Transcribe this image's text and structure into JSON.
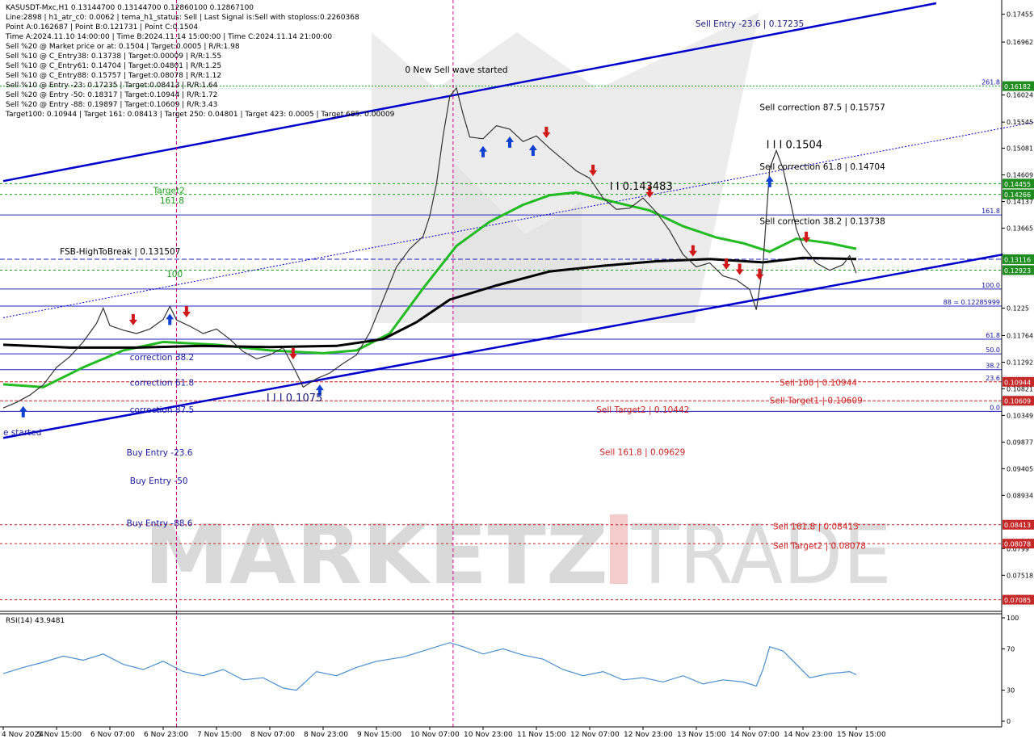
{
  "info_lines": [
    "KASUSDT-Mxc,H1  0.13144700 0.13144700 0.12860100 0.12867100",
    "Line:2898 | h1_atr_c0: 0.0062 | tema_h1_status: Sell | Last Signal is:Sell with stoploss:0.2260368",
    "Point A:0.162687 | Point B:0.121731 | Point C:0.1504",
    "Time A:2024.11.10 14:00:00 | Time B:2024.11.14 15:00:00 | Time C:2024.11.14 21:00:00",
    "Sell %20 @ Market price or at: 0.1504 | Target:0.0005 | R/R:1.98",
    "Sell %10 @ C_Entry38: 0.13738 | Target:0.00009 | R/R:1.55",
    "Sell %10 @ C_Entry61: 0.14704 | Target:0.04801 | R/R:1.25",
    "Sell %10 @ C_Entry88: 0.15757 | Target:0.08078 | R/R:1.12",
    "Sell %10 @ Entry -23: 0.17235 | Target:0.08413 | R/R:1.64",
    "Sell %20 @ Entry -50: 0.18317 | Target:0.10944 | R/R:1.72",
    "Sell %20 @ Entry -88: 0.19897 | Target:0.10609 | R/R:3.43",
    "Target100: 0.10944 | Target 161: 0.08413 | Target 250: 0.04801 | Target 423: 0.0005 | Target 685: 0.00009"
  ],
  "watermark": {
    "left": "MARKETZ",
    "right": "TRADE"
  },
  "rsi_label": "RSI(14) 43.9481",
  "chart_data": {
    "type": "line",
    "title": "KASUSDT-Mxc,H1",
    "ylim": [
      0.0695,
      0.1765
    ],
    "y_ticks": [
      0.17455,
      0.16962,
      0.16024,
      0.15545,
      0.15081,
      0.14609,
      0.14137,
      0.13665,
      0.1225,
      0.11764,
      0.11292,
      0.10821,
      0.10349,
      0.09877,
      0.09405,
      0.08934,
      0.0799,
      0.07518
    ],
    "x_labels": [
      {
        "label": "4 Nov 2024",
        "x": 0
      },
      {
        "label": "5 Nov 15:00",
        "x": 16
      },
      {
        "label": "6 Nov 07:00",
        "x": 32
      },
      {
        "label": "6 Nov 23:00",
        "x": 48
      },
      {
        "label": "7 Nov 15:00",
        "x": 64
      },
      {
        "label": "8 Nov 07:00",
        "x": 80
      },
      {
        "label": "8 Nov 23:00",
        "x": 96
      },
      {
        "label": "9 Nov 15:00",
        "x": 112
      },
      {
        "label": "10 Nov 07:00",
        "x": 128
      },
      {
        "label": "10 Nov 23:00",
        "x": 144
      },
      {
        "label": "11 Nov 15:00",
        "x": 160
      },
      {
        "label": "12 Nov 07:00",
        "x": 176
      },
      {
        "label": "12 Nov 23:00",
        "x": 192
      },
      {
        "label": "13 Nov 15:00",
        "x": 208
      },
      {
        "label": "14 Nov 07:00",
        "x": 224
      },
      {
        "label": "14 Nov 23:00",
        "x": 240
      },
      {
        "label": "15 Nov 15:00",
        "x": 256
      }
    ],
    "price_path": [
      [
        0,
        0.1048
      ],
      [
        4,
        0.1058
      ],
      [
        8,
        0.1071
      ],
      [
        12,
        0.1089
      ],
      [
        16,
        0.112
      ],
      [
        20,
        0.1139
      ],
      [
        24,
        0.1165
      ],
      [
        28,
        0.1198
      ],
      [
        30,
        0.1225
      ],
      [
        32,
        0.1194
      ],
      [
        36,
        0.1186
      ],
      [
        40,
        0.118
      ],
      [
        44,
        0.1188
      ],
      [
        48,
        0.1205
      ],
      [
        50,
        0.1228
      ],
      [
        52,
        0.1204
      ],
      [
        56,
        0.1193
      ],
      [
        60,
        0.118
      ],
      [
        64,
        0.1188
      ],
      [
        68,
        0.117
      ],
      [
        72,
        0.1148
      ],
      [
        76,
        0.1135
      ],
      [
        80,
        0.1142
      ],
      [
        84,
        0.1155
      ],
      [
        88,
        0.111
      ],
      [
        90,
        0.1085
      ],
      [
        94,
        0.11
      ],
      [
        98,
        0.111
      ],
      [
        102,
        0.1127
      ],
      [
        106,
        0.1142
      ],
      [
        110,
        0.1182
      ],
      [
        114,
        0.124
      ],
      [
        118,
        0.1298
      ],
      [
        122,
        0.133
      ],
      [
        126,
        0.1352
      ],
      [
        128,
        0.1388
      ],
      [
        130,
        0.1445
      ],
      [
        132,
        0.153
      ],
      [
        134,
        0.16
      ],
      [
        136,
        0.1615
      ],
      [
        138,
        0.1568
      ],
      [
        140,
        0.1528
      ],
      [
        144,
        0.1525
      ],
      [
        148,
        0.1548
      ],
      [
        152,
        0.1542
      ],
      [
        156,
        0.152
      ],
      [
        160,
        0.153
      ],
      [
        164,
        0.1508
      ],
      [
        168,
        0.1488
      ],
      [
        172,
        0.1468
      ],
      [
        176,
        0.1455
      ],
      [
        180,
        0.142
      ],
      [
        184,
        0.14
      ],
      [
        188,
        0.1402
      ],
      [
        192,
        0.142
      ],
      [
        196,
        0.1395
      ],
      [
        200,
        0.1362
      ],
      [
        204,
        0.132
      ],
      [
        208,
        0.1298
      ],
      [
        212,
        0.1305
      ],
      [
        216,
        0.1282
      ],
      [
        220,
        0.1275
      ],
      [
        224,
        0.1258
      ],
      [
        226,
        0.1222
      ],
      [
        228,
        0.1302
      ],
      [
        230,
        0.1472
      ],
      [
        232,
        0.1504
      ],
      [
        234,
        0.1472
      ],
      [
        236,
        0.142
      ],
      [
        238,
        0.1365
      ],
      [
        240,
        0.1335
      ],
      [
        244,
        0.1305
      ],
      [
        248,
        0.1292
      ],
      [
        252,
        0.1302
      ],
      [
        254,
        0.1318
      ],
      [
        256,
        0.1287
      ]
    ],
    "series": [
      {
        "name": "EMA50",
        "color": "#22bb22",
        "values": [
          [
            0,
            0.109
          ],
          [
            12,
            0.1085
          ],
          [
            24,
            0.112
          ],
          [
            36,
            0.115
          ],
          [
            48,
            0.1165
          ],
          [
            64,
            0.116
          ],
          [
            80,
            0.115
          ],
          [
            96,
            0.1145
          ],
          [
            106,
            0.115
          ],
          [
            116,
            0.118
          ],
          [
            126,
            0.126
          ],
          [
            136,
            0.1335
          ],
          [
            146,
            0.1378
          ],
          [
            156,
            0.1408
          ],
          [
            164,
            0.1425
          ],
          [
            172,
            0.143
          ],
          [
            184,
            0.1412
          ],
          [
            194,
            0.1398
          ],
          [
            204,
            0.137
          ],
          [
            214,
            0.135
          ],
          [
            222,
            0.134
          ],
          [
            230,
            0.1325
          ],
          [
            238,
            0.1348
          ],
          [
            248,
            0.134
          ],
          [
            256,
            0.133
          ]
        ]
      },
      {
        "name": "SMA200",
        "color": "#000000",
        "values": [
          [
            0,
            0.116
          ],
          [
            20,
            0.1155
          ],
          [
            40,
            0.1155
          ],
          [
            60,
            0.1158
          ],
          [
            80,
            0.1156
          ],
          [
            100,
            0.1158
          ],
          [
            114,
            0.117
          ],
          [
            124,
            0.12
          ],
          [
            134,
            0.124
          ],
          [
            148,
            0.1265
          ],
          [
            164,
            0.129
          ],
          [
            180,
            0.13
          ],
          [
            196,
            0.1308
          ],
          [
            212,
            0.1312
          ],
          [
            228,
            0.1306
          ],
          [
            240,
            0.1314
          ],
          [
            256,
            0.1312
          ]
        ]
      }
    ],
    "horizontal_levels": [
      {
        "value": 0.16182,
        "color": "#1a9f1a",
        "dash": "2,2",
        "axis_box": "0.16182",
        "label": "261.8",
        "label_color": "#1010a0"
      },
      {
        "value": 0.14455,
        "color": "#1a9f1a",
        "dash": "3,3",
        "axis_box": "0.14455",
        "label": "",
        "label_color": ""
      },
      {
        "value": 0.14266,
        "color": "#1a9f1a",
        "dash": "3,3",
        "axis_box": "0.14266",
        "label": "",
        "label_color": ""
      },
      {
        "value": 0.139,
        "color": "#2020c0",
        "dash": "",
        "axis_box": "",
        "label": "161.8",
        "label_color": "#1010a0"
      },
      {
        "value": 0.13116,
        "color": "#2020c0",
        "dash": "6,3",
        "axis_box": "0.13116",
        "label": "",
        "label_color": ""
      },
      {
        "value": 0.12923,
        "color": "#1a9f1a",
        "dash": "3,3",
        "axis_box": "0.12923",
        "label": "",
        "label_color": ""
      },
      {
        "value": 0.12587,
        "color": "#2020c0",
        "dash": "",
        "axis_box": "",
        "label": "100.0",
        "label_color": "#1010a0"
      },
      {
        "value": 0.12286,
        "color": "#2020c0",
        "dash": "",
        "axis_box": "",
        "label": "88 = 0.12285999",
        "label_color": "#1010a0"
      },
      {
        "value": 0.117,
        "color": "#2020c0",
        "dash": "",
        "axis_box": "",
        "label": "61.8",
        "label_color": "#1010a0"
      },
      {
        "value": 0.1144,
        "color": "#2020c0",
        "dash": "",
        "axis_box": "",
        "label": "50.0",
        "label_color": "#1010a0"
      },
      {
        "value": 0.1116,
        "color": "#2020c0",
        "dash": "",
        "axis_box": "",
        "label": "38.2",
        "label_color": "#1010a0"
      },
      {
        "value": 0.10944,
        "color": "#cc2222",
        "dash": "4,2",
        "axis_box": "0.10944",
        "label": "23.6",
        "label_color": "#1010a0"
      },
      {
        "value": 0.10609,
        "color": "#cc2222",
        "dash": "4,2",
        "axis_box": "0.10609",
        "label": "",
        "label_color": ""
      },
      {
        "value": 0.1042,
        "color": "#2020c0",
        "dash": "",
        "axis_box": "",
        "label": "0.0",
        "label_color": "#1010a0"
      },
      {
        "value": 0.08413,
        "color": "#cc2222",
        "dash": "3,3",
        "axis_box": "0.08413",
        "label": "",
        "label_color": ""
      },
      {
        "value": 0.08078,
        "color": "#cc2222",
        "dash": "3,3",
        "axis_box": "0.08078",
        "label": "",
        "label_color": ""
      },
      {
        "value": 0.07085,
        "color": "#cc2222",
        "dash": "3,3",
        "axis_box": "0.07085",
        "label": "",
        "label_color": ""
      }
    ],
    "annotations": [
      {
        "text": "Sell Entry -23.6 | 0.17235",
        "x": 224,
        "y": 0.17235,
        "color": "#1a1a7a",
        "anchor": "middle"
      },
      {
        "text": "0 New Sell wave started",
        "x": 136,
        "y": 0.1642,
        "color": "#000000",
        "anchor": "middle"
      },
      {
        "text": "Sell correction 87.5 | 0.15757",
        "x": 227,
        "y": 0.15757,
        "color": "#000000",
        "anchor": "start"
      },
      {
        "text": "I I I 0.1504",
        "x": 229,
        "y": 0.1508,
        "color": "#000000",
        "anchor": "start"
      },
      {
        "text": "Sell correction 61.8 | 0.14704",
        "x": 227,
        "y": 0.14704,
        "color": "#000000",
        "anchor": "start"
      },
      {
        "text": "I I 0.143483",
        "x": 182,
        "y": 0.14348,
        "color": "#000000",
        "anchor": "start"
      },
      {
        "text": "Target2",
        "x": 45,
        "y": 0.1428,
        "color": "#1a9f1a",
        "anchor": "start"
      },
      {
        "text": "161.8",
        "x": 47,
        "y": 0.141,
        "color": "#1a9f1a",
        "anchor": "start"
      },
      {
        "text": "Sell correction 38.2 | 0.13738",
        "x": 227,
        "y": 0.13738,
        "color": "#000000",
        "anchor": "start"
      },
      {
        "text": "FSB-HighToBreak | 0.131507",
        "x": 17,
        "y": 0.132,
        "color": "#000000",
        "anchor": "start"
      },
      {
        "text": "100",
        "x": 49,
        "y": 0.128,
        "color": "#1a9f1a",
        "anchor": "start"
      },
      {
        "text": "correction 38.2",
        "x": 38,
        "y": 0.1133,
        "color": "#1a1a9f",
        "anchor": "start"
      },
      {
        "text": "correction 61.8",
        "x": 38,
        "y": 0.1088,
        "color": "#1a1a9f",
        "anchor": "start"
      },
      {
        "text": "Sell 100 | 0.10944",
        "x": 233,
        "y": 0.1088,
        "color": "#cc2222",
        "anchor": "start"
      },
      {
        "text": "I I I 0.1075",
        "x": 79,
        "y": 0.106,
        "color": "#1a1a7a",
        "anchor": "start"
      },
      {
        "text": "Sell Target1 | 0.10609",
        "x": 230,
        "y": 0.1056,
        "color": "#cc2222",
        "anchor": "start"
      },
      {
        "text": "correction 87.5",
        "x": 38,
        "y": 0.104,
        "color": "#1a1a9f",
        "anchor": "start"
      },
      {
        "text": "Sell Target2 | 0.10442",
        "x": 178,
        "y": 0.104,
        "color": "#cc2222",
        "anchor": "start"
      },
      {
        "text": "e started",
        "x": 0,
        "y": 0.1,
        "color": "#1a1a9f",
        "anchor": "start"
      },
      {
        "text": "Buy Entry -23.6",
        "x": 37,
        "y": 0.0964,
        "color": "#1a1a9f",
        "anchor": "start"
      },
      {
        "text": "Sell 161.8 | 0.09629",
        "x": 179,
        "y": 0.0965,
        "color": "#cc2222",
        "anchor": "start"
      },
      {
        "text": "Buy Entry -50",
        "x": 38,
        "y": 0.0914,
        "color": "#1a1a9f",
        "anchor": "start"
      },
      {
        "text": "Sell 161.8 | 0.08413",
        "x": 231,
        "y": 0.0833,
        "color": "#cc2222",
        "anchor": "start"
      },
      {
        "text": "Sell Target2 | 0.08078",
        "x": 231,
        "y": 0.0799,
        "color": "#cc2222",
        "anchor": "start"
      },
      {
        "text": "Buy Entry -88.6",
        "x": 37,
        "y": 0.0839,
        "color": "#1a1a9f",
        "anchor": "start"
      }
    ],
    "trend_lines": [
      {
        "from": [
          0,
          0.145
        ],
        "to": [
          280,
          0.1765
        ],
        "color": "#0000cc",
        "width": 2.5,
        "dash": ""
      },
      {
        "from": [
          0,
          0.0995
        ],
        "to": [
          300,
          0.132
        ],
        "color": "#0000cc",
        "width": 2.5,
        "dash": ""
      },
      {
        "from": [
          0,
          0.1208
        ],
        "to": [
          310,
          0.1555
        ],
        "color": "#0000cc",
        "width": 1,
        "dash": "2,2"
      }
    ],
    "vertical_lines": [
      {
        "x": 52,
        "color": "#cc0088"
      },
      {
        "x": 135,
        "color": "#cc0088"
      }
    ],
    "signals": [
      {
        "x": 6,
        "dir": "up"
      },
      {
        "x": 39,
        "dir": "down"
      },
      {
        "x": 50,
        "dir": "up"
      },
      {
        "x": 55,
        "dir": "down"
      },
      {
        "x": 87,
        "dir": "down"
      },
      {
        "x": 95,
        "dir": "up"
      },
      {
        "x": 144,
        "dir": "up"
      },
      {
        "x": 152,
        "dir": "up"
      },
      {
        "x": 159,
        "dir": "up"
      },
      {
        "x": 163,
        "dir": "down"
      },
      {
        "x": 177,
        "dir": "down"
      },
      {
        "x": 194,
        "dir": "down"
      },
      {
        "x": 207,
        "dir": "down"
      },
      {
        "x": 217,
        "dir": "down"
      },
      {
        "x": 221,
        "dir": "down"
      },
      {
        "x": 227,
        "dir": "down"
      },
      {
        "x": 230,
        "dir": "up"
      },
      {
        "x": 241,
        "dir": "down"
      }
    ],
    "rsi": {
      "label": "RSI(14)",
      "value": 43.9481,
      "ylim": [
        0,
        100
      ],
      "ticks": [
        100,
        70,
        30,
        0
      ],
      "values": [
        [
          0,
          46
        ],
        [
          6,
          52
        ],
        [
          12,
          57
        ],
        [
          18,
          63
        ],
        [
          24,
          59
        ],
        [
          30,
          65
        ],
        [
          36,
          55
        ],
        [
          42,
          50
        ],
        [
          48,
          58
        ],
        [
          54,
          48
        ],
        [
          60,
          44
        ],
        [
          66,
          50
        ],
        [
          72,
          40
        ],
        [
          78,
          42
        ],
        [
          84,
          32
        ],
        [
          88,
          30
        ],
        [
          94,
          48
        ],
        [
          100,
          44
        ],
        [
          106,
          52
        ],
        [
          112,
          58
        ],
        [
          120,
          62
        ],
        [
          128,
          70
        ],
        [
          134,
          76
        ],
        [
          138,
          72
        ],
        [
          144,
          65
        ],
        [
          150,
          70
        ],
        [
          156,
          64
        ],
        [
          162,
          60
        ],
        [
          168,
          50
        ],
        [
          174,
          44
        ],
        [
          180,
          48
        ],
        [
          186,
          40
        ],
        [
          192,
          42
        ],
        [
          198,
          38
        ],
        [
          204,
          44
        ],
        [
          210,
          36
        ],
        [
          216,
          40
        ],
        [
          222,
          38
        ],
        [
          226,
          34
        ],
        [
          228,
          50
        ],
        [
          230,
          72
        ],
        [
          234,
          68
        ],
        [
          238,
          55
        ],
        [
          242,
          42
        ],
        [
          248,
          46
        ],
        [
          254,
          48
        ],
        [
          256,
          45
        ]
      ]
    },
    "grid": false,
    "legend": "none"
  }
}
